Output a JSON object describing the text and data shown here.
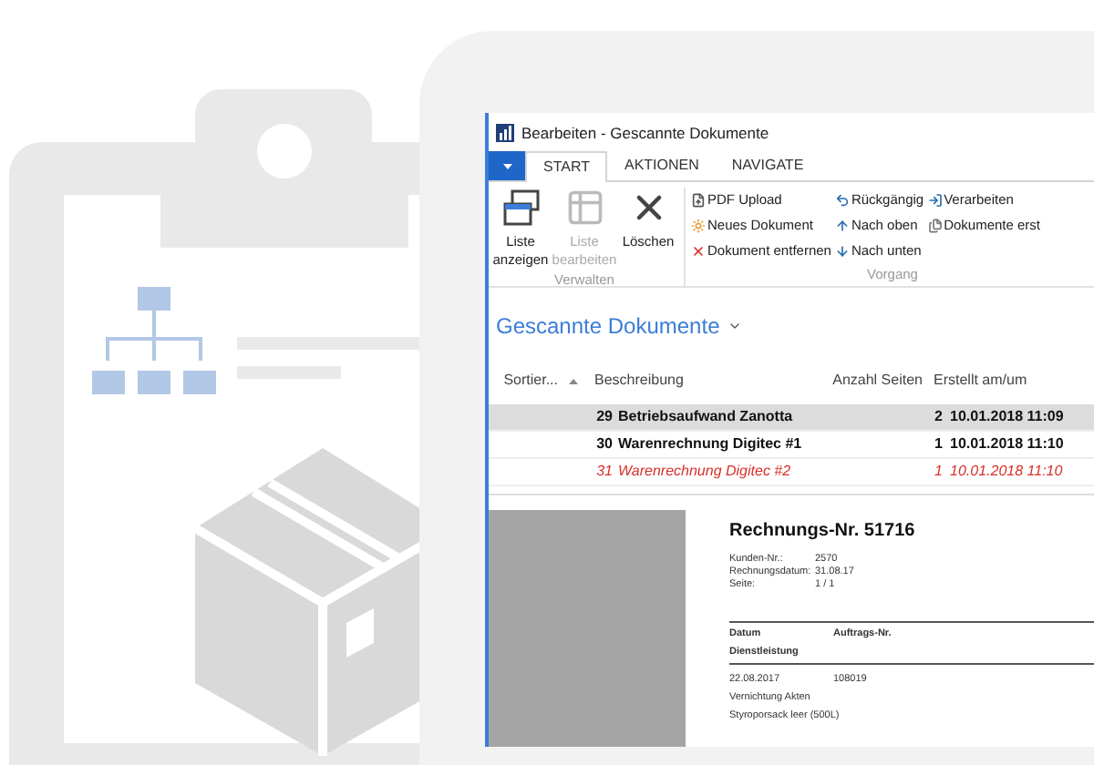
{
  "window": {
    "title": "Bearbeiten - Gescannte Dokumente"
  },
  "tabs": [
    {
      "label": "START",
      "selected": true
    },
    {
      "label": "AKTIONEN",
      "selected": false
    },
    {
      "label": "NAVIGATE",
      "selected": false
    }
  ],
  "ribbon": {
    "groups": [
      {
        "label": "Verwalten",
        "large_buttons": [
          {
            "label": "Liste anzeigen",
            "disabled": false
          },
          {
            "label": "Liste bearbeiten",
            "disabled": true
          },
          {
            "label": "Löschen",
            "disabled": false
          }
        ]
      },
      {
        "label": "Vorgang",
        "columns": [
          [
            "PDF Upload",
            "Neues Dokument",
            "Dokument entfernen"
          ],
          [
            "Rückgängig",
            "Nach oben",
            "Nach unten"
          ],
          [
            "Verarbeiten",
            "Dokumente erst"
          ]
        ]
      }
    ]
  },
  "page_title": "Gescannte Dokumente",
  "table": {
    "columns": [
      "Sortier...",
      "Beschreibung",
      "Anzahl Seiten",
      "Erstellt am/um"
    ],
    "rows": [
      {
        "number": "29",
        "description": "Betriebsaufwand Zanotta",
        "pages": "2",
        "created": "10.01.2018 11:09",
        "selected": true,
        "kind": "bold"
      },
      {
        "number": "30",
        "description": "Warenrechnung Digitec #1",
        "pages": "1",
        "created": "10.01.2018 11:10",
        "selected": false,
        "kind": "bold"
      },
      {
        "number": "31",
        "description": "Warenrechnung Digitec #2",
        "pages": "1",
        "created": "10.01.2018 11:10",
        "selected": false,
        "kind": "red"
      }
    ]
  },
  "preview": {
    "title": "Rechnungs-Nr. 51716",
    "fields": [
      {
        "label": "Kunden-Nr.:",
        "value": "2570"
      },
      {
        "label": "Rechnungsdatum:",
        "value": "31.08.17"
      },
      {
        "label": "Seite:",
        "value": "1 / 1"
      }
    ],
    "header": [
      "Datum",
      "Auftrags-Nr.",
      "Dienstleistung"
    ],
    "line": {
      "date": "22.08.2017",
      "order": "108019"
    },
    "items": [
      "Vernichtung Akten",
      "Styroporsack leer (500L)"
    ]
  }
}
